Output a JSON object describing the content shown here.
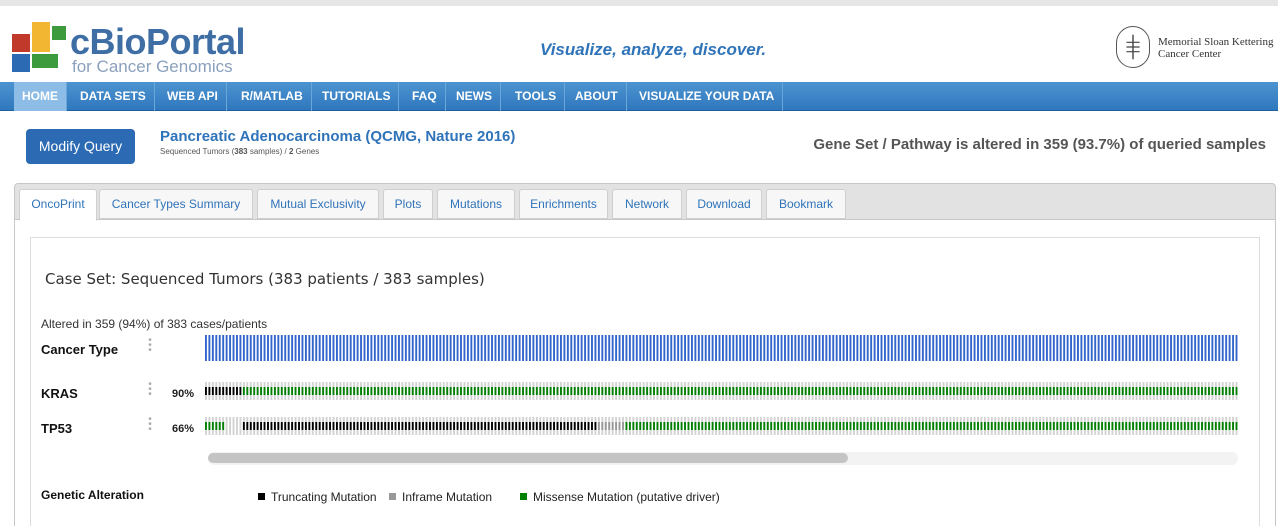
{
  "brand": {
    "title": "cBioPortal",
    "subtitle": "for Cancer Genomics",
    "tagline": "Visualize, analyze, discover.",
    "partner_line1": "Memorial Sloan Kettering",
    "partner_line2": "Cancer Center",
    "colors": {
      "primary": "#2f73b9",
      "logo_red": "#c0392b",
      "logo_green": "#3d9a3d",
      "logo_yellow": "#f2b632",
      "logo_blue": "#2c6bb3"
    }
  },
  "nav": {
    "items": [
      {
        "label": "HOME",
        "active": true
      },
      {
        "label": "DATA SETS"
      },
      {
        "label": "WEB API"
      },
      {
        "label": "R/MATLAB"
      },
      {
        "label": "TUTORIALS"
      },
      {
        "label": "FAQ"
      },
      {
        "label": "NEWS"
      },
      {
        "label": "TOOLS"
      },
      {
        "label": "ABOUT"
      },
      {
        "label": "VISUALIZE YOUR DATA"
      }
    ]
  },
  "query": {
    "modify_label": "Modify Query",
    "study_title": "Pancreatic Adenocarcinoma (QCMG, Nature 2016)",
    "study_sub_prefix": "Sequenced Tumors (",
    "study_sub_samples": "383",
    "study_sub_mid": " samples) / ",
    "study_sub_genes": "2",
    "study_sub_suffix": " Genes",
    "altered_summary": "Gene Set / Pathway is altered in 359 (93.7%) of queried samples"
  },
  "tabs": [
    {
      "label": "OncoPrint",
      "active": true
    },
    {
      "label": "Cancer Types Summary"
    },
    {
      "label": "Mutual Exclusivity"
    },
    {
      "label": "Plots"
    },
    {
      "label": "Mutations"
    },
    {
      "label": "Enrichments"
    },
    {
      "label": "Network"
    },
    {
      "label": "Download"
    },
    {
      "label": "Bookmark"
    }
  ],
  "oncoprint": {
    "case_set": "Case Set: Sequenced Tumors (383 patients / 383 samples)",
    "altered_in": "Altered in 359 (94%) of 383 cases/patients",
    "clinical_track": "Cancer Type",
    "genes": [
      {
        "name": "KRAS",
        "pct": "90%"
      },
      {
        "name": "TP53",
        "pct": "66%"
      }
    ],
    "legend_title": "Genetic Alteration",
    "legend": [
      {
        "label": "Truncating Mutation",
        "color": "#000000"
      },
      {
        "label": "Inframe Mutation",
        "color": "#999999"
      },
      {
        "label": "Missense Mutation (putative driver)",
        "color": "#008000"
      }
    ],
    "colors": {
      "cancer_type": "#3366cc",
      "unaltered": "#d3d3d3"
    }
  }
}
